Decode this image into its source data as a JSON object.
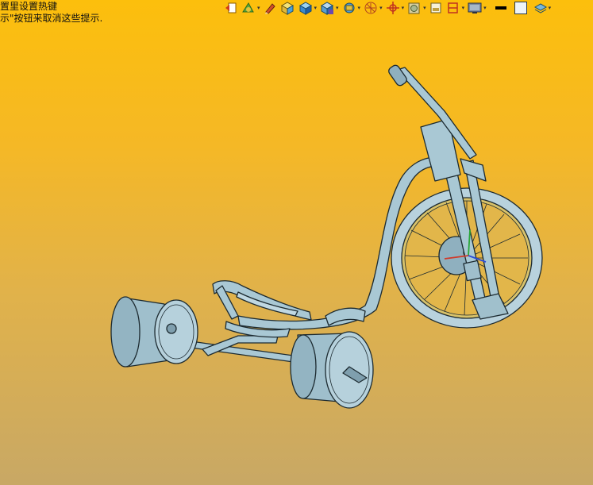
{
  "viewport": {
    "hint_line1": "置里设置热键",
    "hint_line2": "示\"按钮来取消这些提示."
  },
  "toolbar": {
    "items": [
      {
        "icon": "previous-view-icon",
        "dropdown": false
      },
      {
        "icon": "rotate-view-icon",
        "dropdown": true
      },
      {
        "icon": "pencil-icon",
        "dropdown": false
      },
      {
        "icon": "shaded-cube-icon",
        "dropdown": false
      },
      {
        "icon": "view-orientation-cube-icon",
        "dropdown": true
      },
      {
        "icon": "display-style-icon",
        "dropdown": true
      },
      {
        "icon": "section-view-icon",
        "dropdown": true
      },
      {
        "icon": "axis-triad-icon",
        "dropdown": true
      },
      {
        "icon": "appearance-icon",
        "dropdown": true
      },
      {
        "icon": "scene-icon",
        "dropdown": false
      },
      {
        "icon": "hide-show-icon",
        "dropdown": true
      },
      {
        "icon": "monitor-icon",
        "dropdown": true
      },
      {
        "icon": "black-line-icon",
        "dropdown": false
      },
      {
        "icon": "white-square-icon",
        "dropdown": false
      },
      {
        "icon": "layers-icon",
        "dropdown": true
      }
    ],
    "dropdown_glyph": "▾"
  },
  "model": {
    "icon": "drift-trike-3d-model",
    "colors": {
      "body": "#a9c8d4",
      "edge": "#1c2a30",
      "shadow": "#7fa3b2",
      "highlight": "#d4e6ec"
    }
  }
}
